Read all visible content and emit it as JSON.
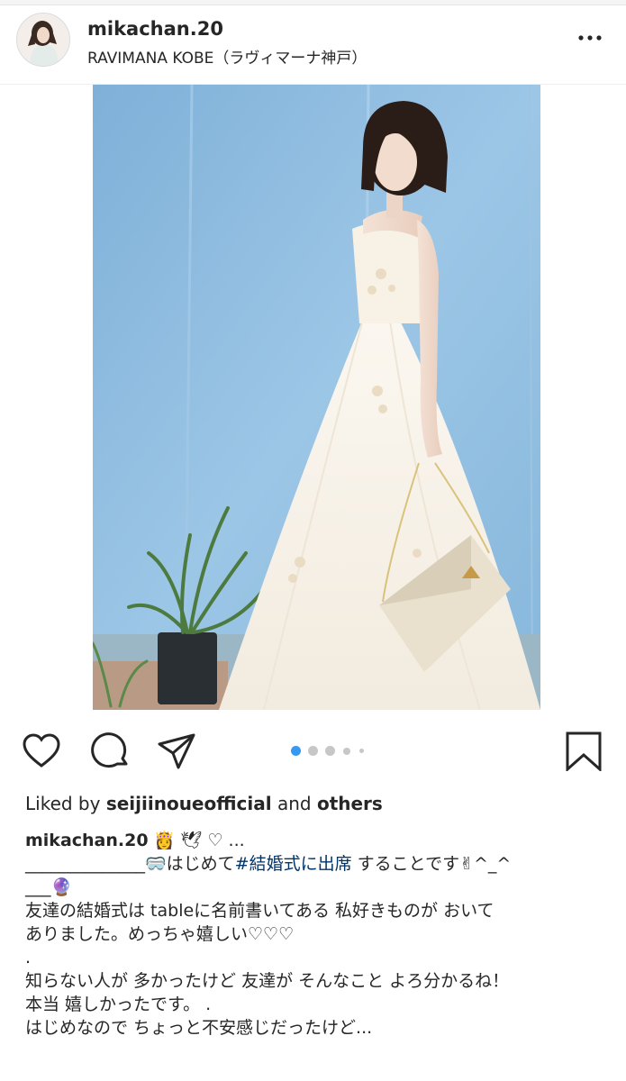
{
  "post": {
    "username": "mikachan.20",
    "location": "RAVIMANA KOBE（ラヴィマーナ神戸）"
  },
  "likes": {
    "prefix": "Liked by ",
    "user": "seijiinoueofficial",
    "middle": " and ",
    "others": "others"
  },
  "carousel": {
    "dot_count": 5,
    "active_index": 0
  },
  "caption": {
    "username": "mikachan.20",
    "first_line_tail": "👸 🕊 ♡ ...",
    "line2_prefix": "______________🥽はじめて",
    "line2_hashtag": "#結婚式に出席",
    "line2_suffix": " することです✌^_^",
    "line3": "___🔮",
    "line4": "友達の結婚式は tableに名前書いてある 私好きものが おいて",
    "line5": "ありました。めっちゃ嬉しい♡♡♡",
    "line6": ".",
    "line7": "知らない人が 多かったけど 友達が そんなこと よろ分かるね！",
    "line8": "本当 嬉しかったです。 .",
    "line9": "はじめなので ちょっと不安感じだったけど..."
  },
  "colors": {
    "dot_active": "#3897f0",
    "dot_inactive": "#c7c7c7",
    "hashtag": "#003569",
    "photo_wall": "#8fb9dc"
  },
  "icons": [
    "more-icon",
    "heart-icon",
    "comment-icon",
    "share-icon",
    "bookmark-icon"
  ]
}
